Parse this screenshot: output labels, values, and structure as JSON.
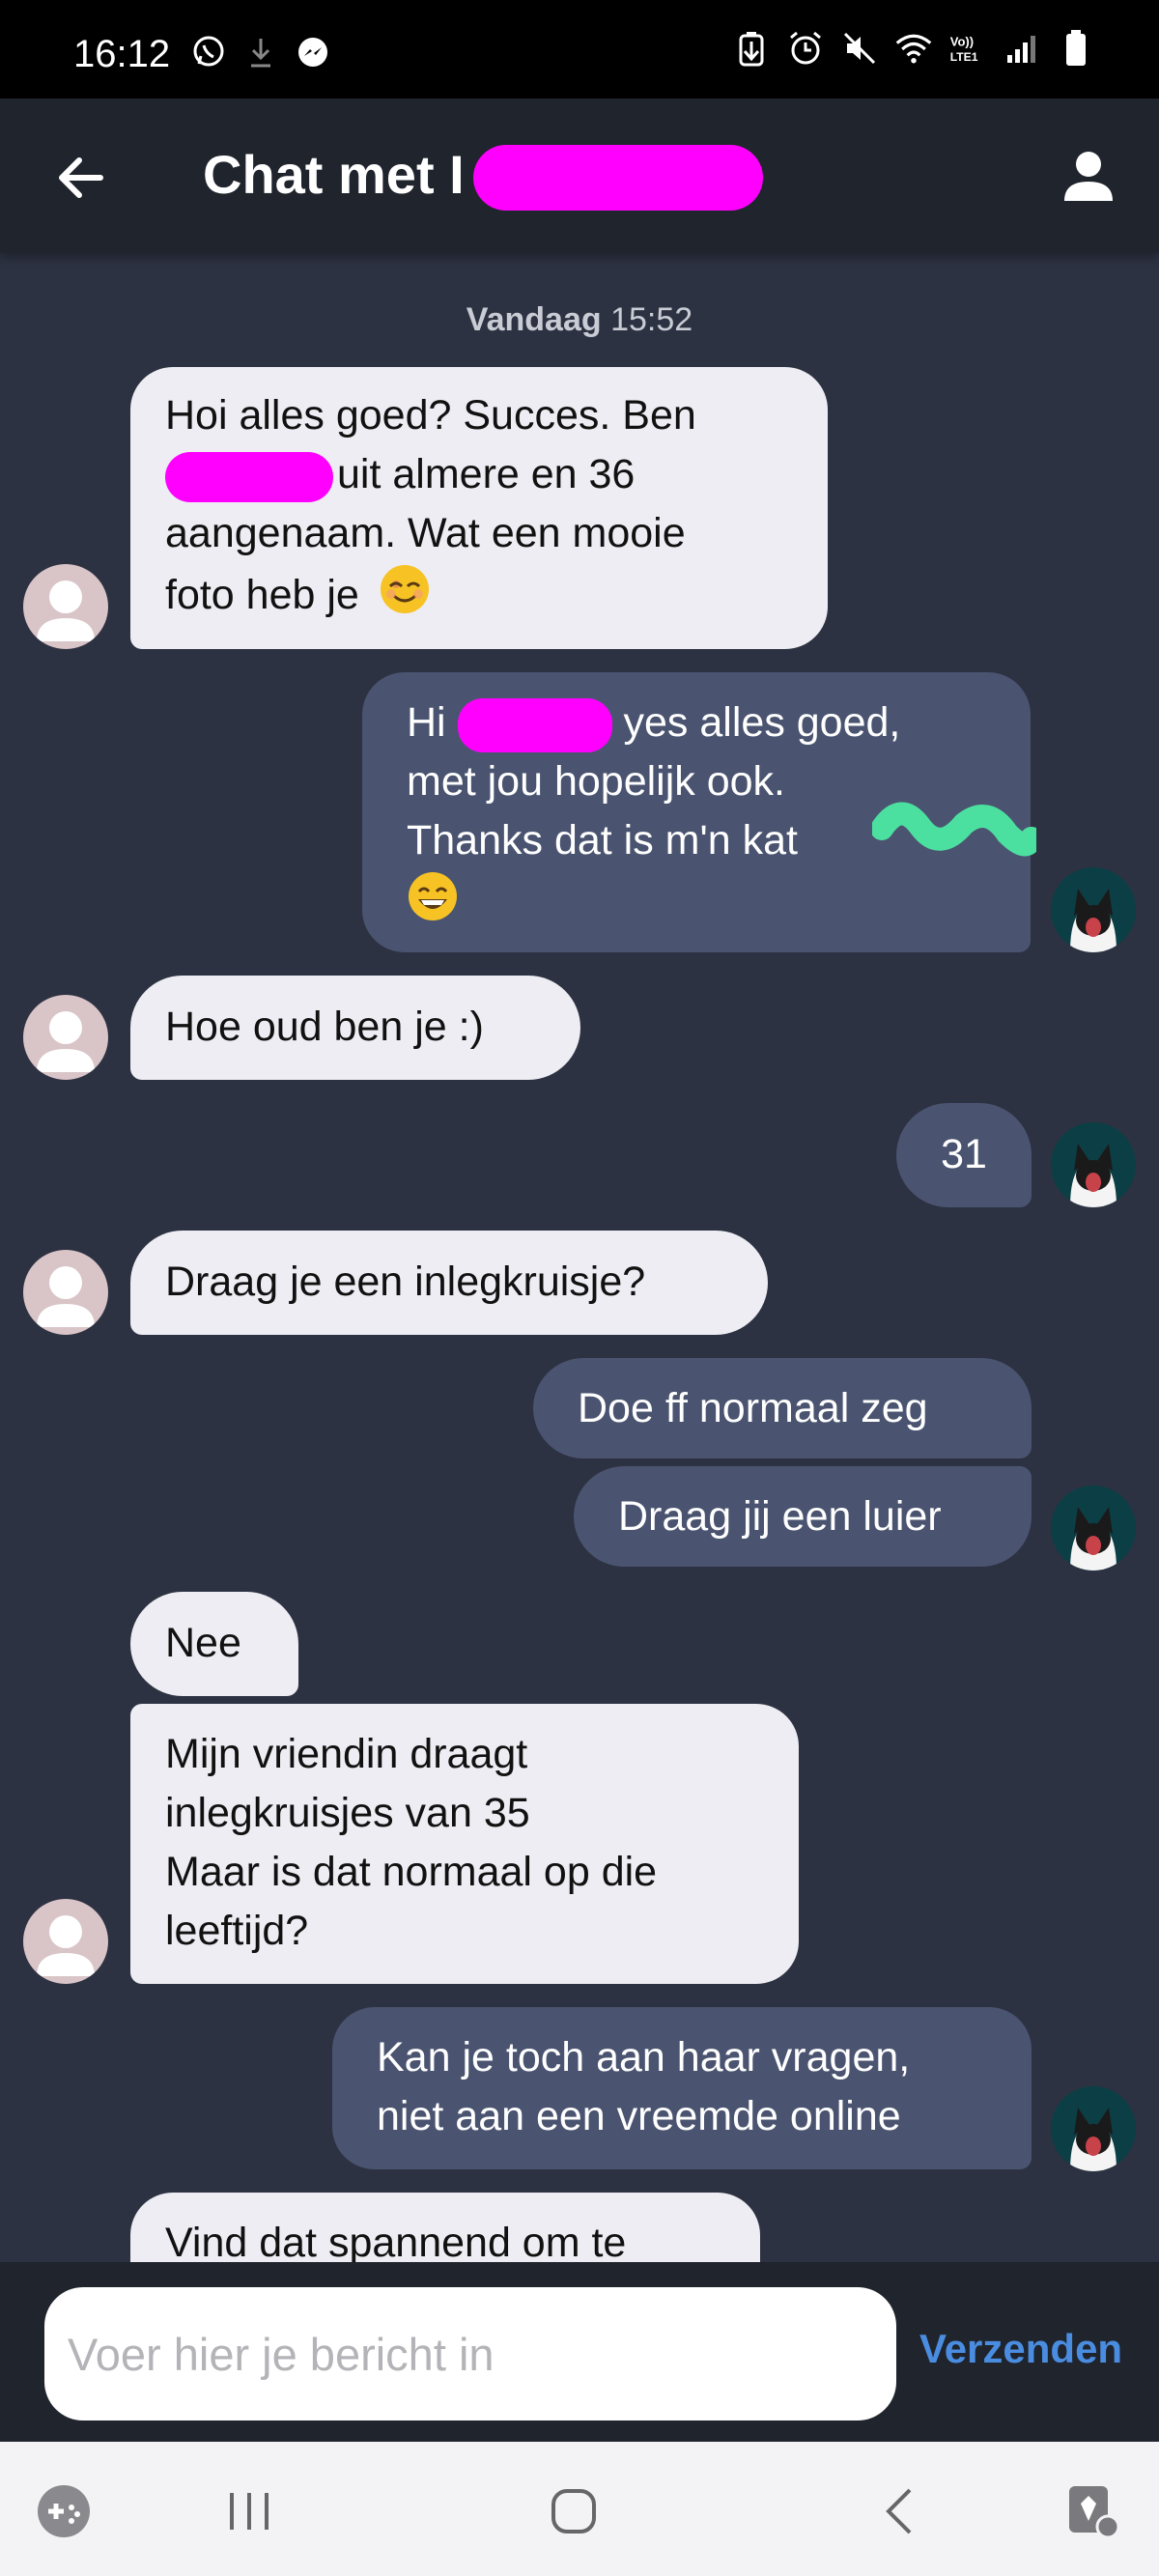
{
  "status_bar": {
    "time": "16:12"
  },
  "header": {
    "title": "Chat met I"
  },
  "chat": {
    "date_separator": {
      "day": "Vandaag",
      "time": "15:52"
    },
    "messages": [
      {
        "dir": "in",
        "lines": [
          "Hoi alles goed? Succes. Ben",
          "uit almere en 36",
          "aangenaam. Wat een mooie",
          "foto heb je"
        ]
      },
      {
        "dir": "out",
        "lines": [
          "Hi",
          "yes alles goed,",
          "met jou hopelijk ook.",
          "Thanks dat is m'n kat"
        ]
      },
      {
        "dir": "in",
        "text": "Hoe oud ben je :)"
      },
      {
        "dir": "out",
        "text": "31"
      },
      {
        "dir": "in",
        "text": "Draag je een inlegkruisje?"
      },
      {
        "dir": "out",
        "text": "Doe ff normaal zeg"
      },
      {
        "dir": "out",
        "text": "Draag jij een luier"
      },
      {
        "dir": "in",
        "text": "Nee"
      },
      {
        "dir": "in",
        "lines": [
          "Mijn vriendin draagt",
          "inlegkruisjes van 35",
          "Maar is dat normaal op die",
          "leeftijd?"
        ]
      },
      {
        "dir": "out",
        "lines": [
          "Kan je toch aan haar vragen,",
          "niet aan een vreemde online"
        ]
      },
      {
        "dir": "in",
        "text": "Vind dat spannend om te"
      }
    ]
  },
  "composer": {
    "placeholder": "Voer hier je bericht in",
    "send_label": "Verzenden"
  },
  "icons": [
    "viber-icon",
    "download-icon",
    "messenger-icon",
    "battery-saver-icon",
    "alarm-icon",
    "mute-icon",
    "wifi-icon",
    "volte-icon",
    "signal-icon",
    "battery-icon",
    "back-arrow-icon",
    "profile-icon",
    "smiling-face-emoji",
    "grinning-face-emoji",
    "game-launcher-icon",
    "recent-apps-icon",
    "home-icon",
    "nav-back-icon",
    "accessibility-icon"
  ],
  "colors": {
    "background": "#2d3242",
    "incoming_bubble": "#ededf3",
    "outgoing_bubble": "#4a5470",
    "send_accent": "#4a8de0",
    "redaction": "#ff00ff"
  }
}
